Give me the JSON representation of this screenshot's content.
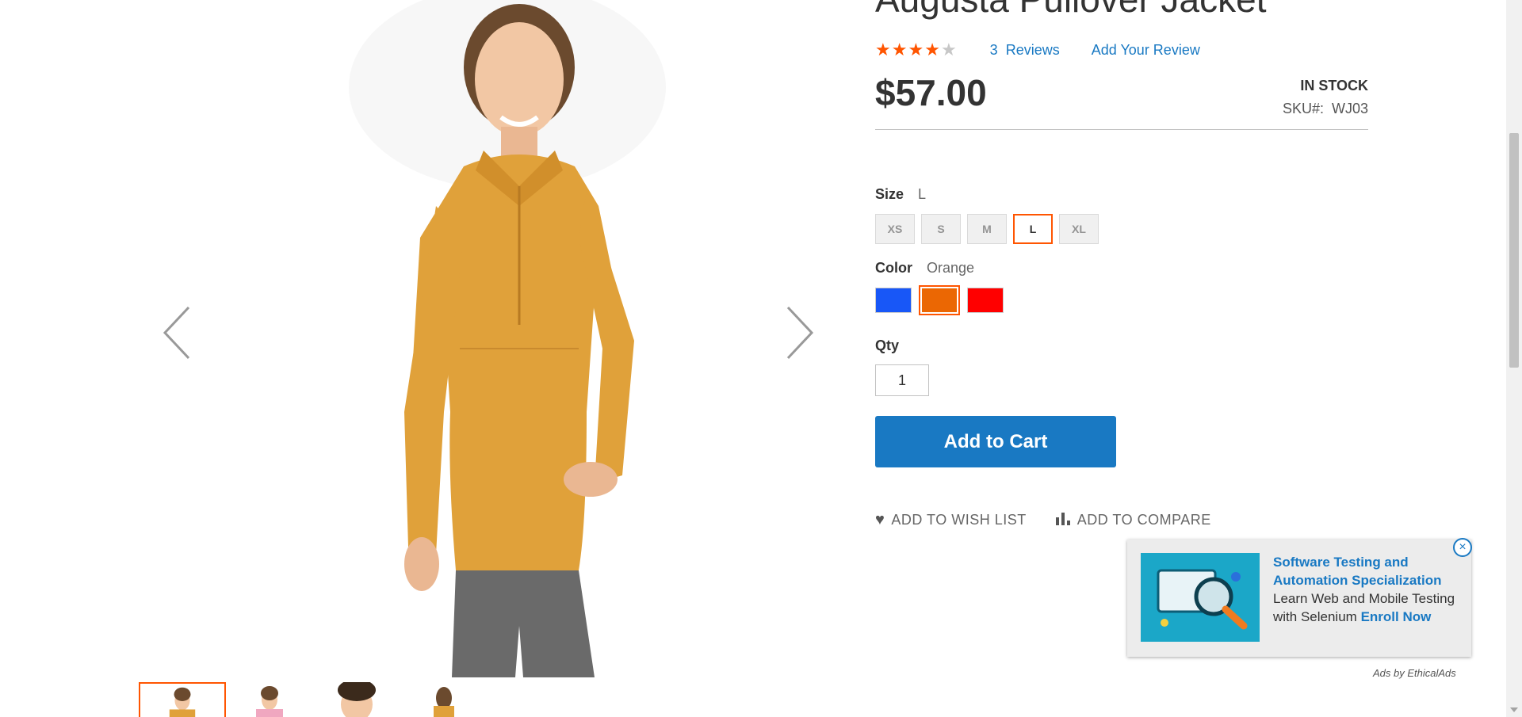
{
  "product": {
    "title": "Augusta Pullover Jacket",
    "rating_percent": 80,
    "reviews_count": "3",
    "reviews_label": "Reviews",
    "add_review_label": "Add Your Review",
    "price": "$57.00",
    "stock": "In stock",
    "sku_label": "SKU#:",
    "sku": "WJ03"
  },
  "options": {
    "size": {
      "label": "Size",
      "selected": "L",
      "values": [
        "XS",
        "S",
        "M",
        "L",
        "XL"
      ]
    },
    "color": {
      "label": "Color",
      "selected": "Orange",
      "swatches": [
        {
          "name": "Blue",
          "hex": "#1857f7"
        },
        {
          "name": "Orange",
          "hex": "#eb6703"
        },
        {
          "name": "Red",
          "hex": "#ff0000"
        }
      ]
    }
  },
  "qty": {
    "label": "Qty",
    "value": "1"
  },
  "buttons": {
    "add_to_cart": "Add to Cart",
    "wishlist": "Add to Wish List",
    "compare": "Add to Compare"
  },
  "ad": {
    "title": "Software Testing and Automation Specialization",
    "body": "Learn Web and Mobile Testing with Selenium",
    "cta": "Enroll Now",
    "credit": "Ads by EthicalAds",
    "close_icon": "×"
  },
  "colors": {
    "accent": "#ff5501",
    "link": "#1979c3",
    "garment": "#e0a13a"
  }
}
